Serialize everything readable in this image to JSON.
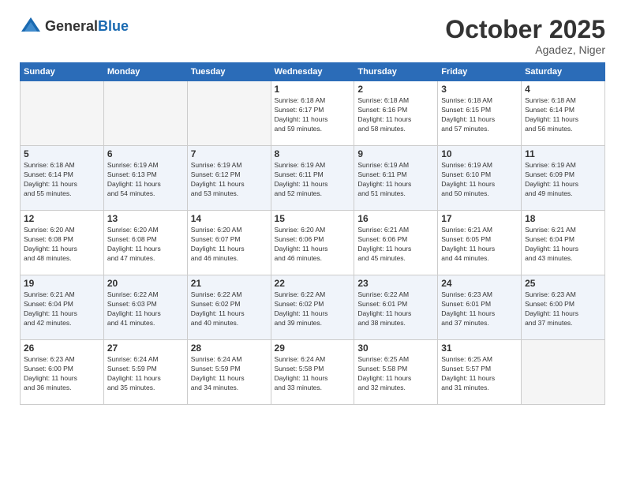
{
  "header": {
    "logo_general": "General",
    "logo_blue": "Blue",
    "month_title": "October 2025",
    "location": "Agadez, Niger"
  },
  "weekdays": [
    "Sunday",
    "Monday",
    "Tuesday",
    "Wednesday",
    "Thursday",
    "Friday",
    "Saturday"
  ],
  "weeks": [
    [
      {
        "day": "",
        "info": ""
      },
      {
        "day": "",
        "info": ""
      },
      {
        "day": "",
        "info": ""
      },
      {
        "day": "1",
        "info": "Sunrise: 6:18 AM\nSunset: 6:17 PM\nDaylight: 11 hours\nand 59 minutes."
      },
      {
        "day": "2",
        "info": "Sunrise: 6:18 AM\nSunset: 6:16 PM\nDaylight: 11 hours\nand 58 minutes."
      },
      {
        "day": "3",
        "info": "Sunrise: 6:18 AM\nSunset: 6:15 PM\nDaylight: 11 hours\nand 57 minutes."
      },
      {
        "day": "4",
        "info": "Sunrise: 6:18 AM\nSunset: 6:14 PM\nDaylight: 11 hours\nand 56 minutes."
      }
    ],
    [
      {
        "day": "5",
        "info": "Sunrise: 6:18 AM\nSunset: 6:14 PM\nDaylight: 11 hours\nand 55 minutes."
      },
      {
        "day": "6",
        "info": "Sunrise: 6:19 AM\nSunset: 6:13 PM\nDaylight: 11 hours\nand 54 minutes."
      },
      {
        "day": "7",
        "info": "Sunrise: 6:19 AM\nSunset: 6:12 PM\nDaylight: 11 hours\nand 53 minutes."
      },
      {
        "day": "8",
        "info": "Sunrise: 6:19 AM\nSunset: 6:11 PM\nDaylight: 11 hours\nand 52 minutes."
      },
      {
        "day": "9",
        "info": "Sunrise: 6:19 AM\nSunset: 6:11 PM\nDaylight: 11 hours\nand 51 minutes."
      },
      {
        "day": "10",
        "info": "Sunrise: 6:19 AM\nSunset: 6:10 PM\nDaylight: 11 hours\nand 50 minutes."
      },
      {
        "day": "11",
        "info": "Sunrise: 6:19 AM\nSunset: 6:09 PM\nDaylight: 11 hours\nand 49 minutes."
      }
    ],
    [
      {
        "day": "12",
        "info": "Sunrise: 6:20 AM\nSunset: 6:08 PM\nDaylight: 11 hours\nand 48 minutes."
      },
      {
        "day": "13",
        "info": "Sunrise: 6:20 AM\nSunset: 6:08 PM\nDaylight: 11 hours\nand 47 minutes."
      },
      {
        "day": "14",
        "info": "Sunrise: 6:20 AM\nSunset: 6:07 PM\nDaylight: 11 hours\nand 46 minutes."
      },
      {
        "day": "15",
        "info": "Sunrise: 6:20 AM\nSunset: 6:06 PM\nDaylight: 11 hours\nand 46 minutes."
      },
      {
        "day": "16",
        "info": "Sunrise: 6:21 AM\nSunset: 6:06 PM\nDaylight: 11 hours\nand 45 minutes."
      },
      {
        "day": "17",
        "info": "Sunrise: 6:21 AM\nSunset: 6:05 PM\nDaylight: 11 hours\nand 44 minutes."
      },
      {
        "day": "18",
        "info": "Sunrise: 6:21 AM\nSunset: 6:04 PM\nDaylight: 11 hours\nand 43 minutes."
      }
    ],
    [
      {
        "day": "19",
        "info": "Sunrise: 6:21 AM\nSunset: 6:04 PM\nDaylight: 11 hours\nand 42 minutes."
      },
      {
        "day": "20",
        "info": "Sunrise: 6:22 AM\nSunset: 6:03 PM\nDaylight: 11 hours\nand 41 minutes."
      },
      {
        "day": "21",
        "info": "Sunrise: 6:22 AM\nSunset: 6:02 PM\nDaylight: 11 hours\nand 40 minutes."
      },
      {
        "day": "22",
        "info": "Sunrise: 6:22 AM\nSunset: 6:02 PM\nDaylight: 11 hours\nand 39 minutes."
      },
      {
        "day": "23",
        "info": "Sunrise: 6:22 AM\nSunset: 6:01 PM\nDaylight: 11 hours\nand 38 minutes."
      },
      {
        "day": "24",
        "info": "Sunrise: 6:23 AM\nSunset: 6:01 PM\nDaylight: 11 hours\nand 37 minutes."
      },
      {
        "day": "25",
        "info": "Sunrise: 6:23 AM\nSunset: 6:00 PM\nDaylight: 11 hours\nand 37 minutes."
      }
    ],
    [
      {
        "day": "26",
        "info": "Sunrise: 6:23 AM\nSunset: 6:00 PM\nDaylight: 11 hours\nand 36 minutes."
      },
      {
        "day": "27",
        "info": "Sunrise: 6:24 AM\nSunset: 5:59 PM\nDaylight: 11 hours\nand 35 minutes."
      },
      {
        "day": "28",
        "info": "Sunrise: 6:24 AM\nSunset: 5:59 PM\nDaylight: 11 hours\nand 34 minutes."
      },
      {
        "day": "29",
        "info": "Sunrise: 6:24 AM\nSunset: 5:58 PM\nDaylight: 11 hours\nand 33 minutes."
      },
      {
        "day": "30",
        "info": "Sunrise: 6:25 AM\nSunset: 5:58 PM\nDaylight: 11 hours\nand 32 minutes."
      },
      {
        "day": "31",
        "info": "Sunrise: 6:25 AM\nSunset: 5:57 PM\nDaylight: 11 hours\nand 31 minutes."
      },
      {
        "day": "",
        "info": ""
      }
    ]
  ]
}
